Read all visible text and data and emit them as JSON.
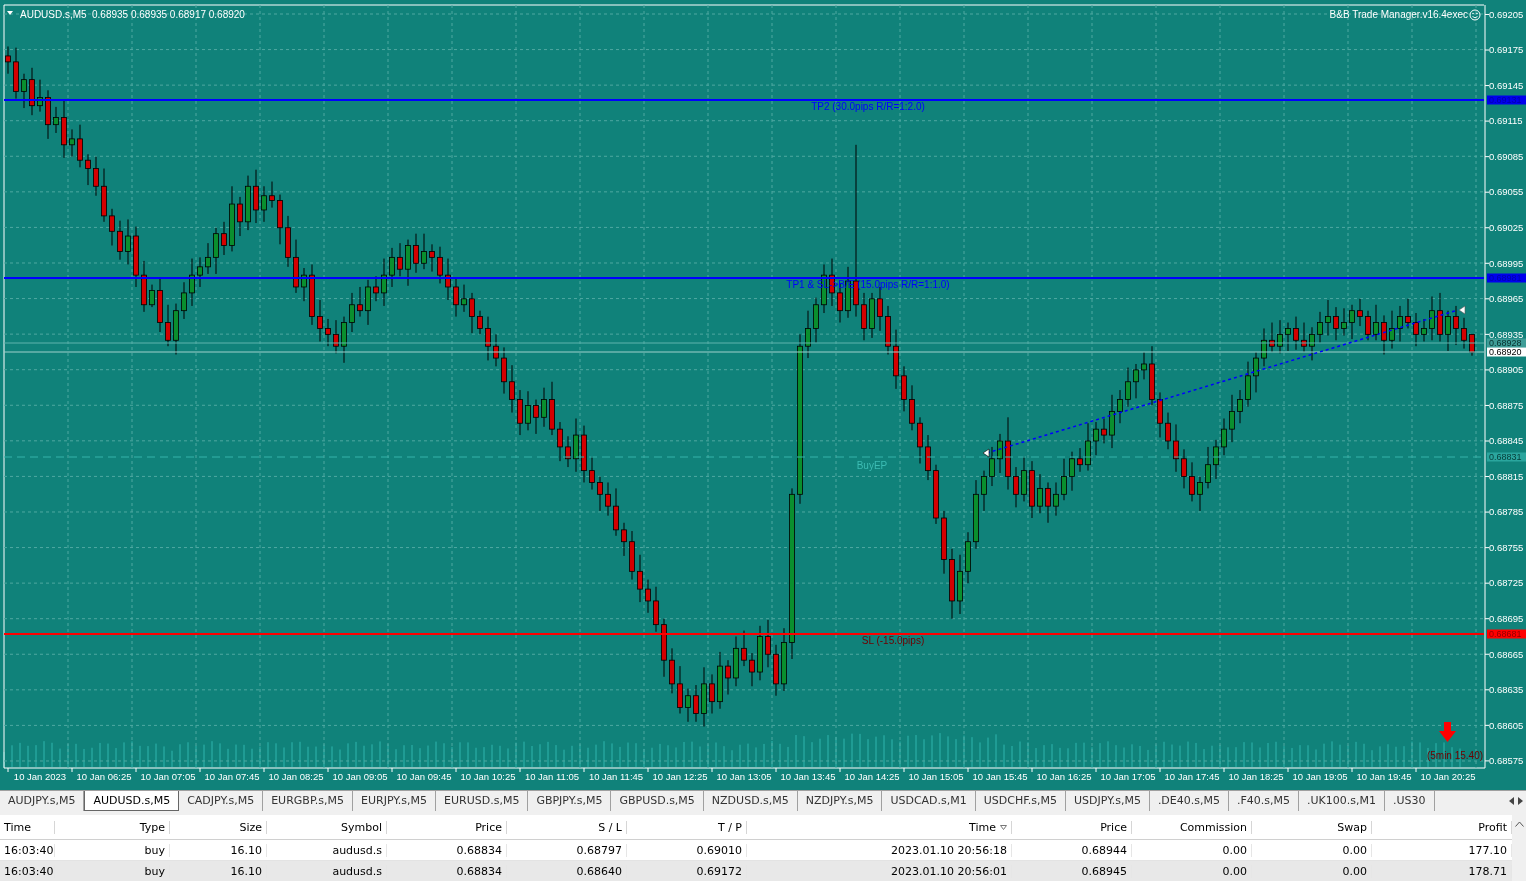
{
  "chart": {
    "symbol": "AUDUSD.s,M5",
    "ohlc": "0.68935 0.68935 0.68917 0.68920",
    "expert": "B&B Trade Manager.v16.4exec",
    "levels": [
      {
        "kind": "take_profit",
        "label": "TP2 (30.0pips R/R=1:2.0)",
        "price": "0.69131"
      },
      {
        "kind": "take_profit",
        "label": "TP1 & SL->B/E (15.0pips R/R=1:1.0)",
        "price": "0.68981"
      },
      {
        "kind": "ask",
        "price": "0.68928"
      },
      {
        "kind": "bid",
        "price": "0.68920"
      },
      {
        "kind": "entry",
        "label": "BuyEP",
        "price": "0.68831"
      },
      {
        "kind": "stop_loss",
        "label": "SL (-15.0pips)",
        "price": "0.68681"
      }
    ],
    "timer": "(5min 15.40)",
    "chart_data": {
      "type": "candlestick",
      "grid": true,
      "categories": [
        null,
        null,
        null,
        null,
        "10 Jan 2023",
        null,
        null,
        null,
        null,
        null,
        null,
        null,
        "10 Jan 06:25",
        null,
        null,
        null,
        null,
        null,
        null,
        null,
        "10 Jan 07:05",
        null,
        null,
        null,
        null,
        null,
        null,
        null,
        "10 Jan 07:45",
        null,
        null,
        null,
        null,
        null,
        null,
        null,
        "10 Jan 08:25",
        null,
        null,
        null,
        null,
        null,
        null,
        null,
        "10 Jan 09:05",
        null,
        null,
        null,
        null,
        null,
        null,
        null,
        "10 Jan 09:45",
        null,
        null,
        null,
        null,
        null,
        null,
        null,
        "10 Jan 10:25",
        null,
        null,
        null,
        null,
        null,
        null,
        null,
        "10 Jan 11:05",
        null,
        null,
        null,
        null,
        null,
        null,
        null,
        "10 Jan 11:45",
        null,
        null,
        null,
        null,
        null,
        null,
        null,
        "10 Jan 12:25",
        null,
        null,
        null,
        null,
        null,
        null,
        null,
        "10 Jan 13:05",
        null,
        null,
        null,
        null,
        null,
        null,
        null,
        "10 Jan 13:45",
        null,
        null,
        null,
        null,
        null,
        null,
        null,
        "10 Jan 14:25",
        null,
        null,
        null,
        null,
        null,
        null,
        null,
        "10 Jan 15:05",
        null,
        null,
        null,
        null,
        null,
        null,
        null,
        "10 Jan 15:45",
        null,
        null,
        null,
        null,
        null,
        null,
        null,
        "10 Jan 16:25",
        null,
        null,
        null,
        null,
        null,
        null,
        null,
        "10 Jan 17:05",
        null,
        null,
        null,
        null,
        null,
        null,
        null,
        "10 Jan 17:45",
        null,
        null,
        null,
        null,
        null,
        null,
        null,
        "10 Jan 18:25",
        null,
        null,
        null,
        null,
        null,
        null,
        null,
        "10 Jan 19:05",
        null,
        null,
        null,
        null,
        null,
        null,
        null,
        "10 Jan 19:45",
        null,
        null,
        null,
        null,
        null,
        null,
        null,
        "10 Jan 20:25",
        null,
        null,
        null
      ],
      "ylim": [
        0.68569,
        0.69213
      ],
      "yticks": [
        0.69205,
        0.69175,
        0.69145,
        0.69115,
        0.69085,
        0.69055,
        0.69025,
        0.68995,
        0.68965,
        0.68935,
        0.68905,
        0.68875,
        0.68845,
        0.68815,
        0.68785,
        0.68755,
        0.68725,
        0.68695,
        0.68665,
        0.68635,
        0.68605,
        0.68575
      ],
      "ohlc": [
        [
          0.6917,
          0.69178,
          0.69155,
          0.69165
        ],
        [
          0.69165,
          0.69177,
          0.69134,
          0.6914
        ],
        [
          0.6914,
          0.69155,
          0.69126,
          0.6915
        ],
        [
          0.6915,
          0.6916,
          0.6912,
          0.69128
        ],
        [
          0.69128,
          0.6915,
          0.69123,
          0.69135
        ],
        [
          0.69135,
          0.69141,
          0.691,
          0.69112
        ],
        [
          0.69112,
          0.69127,
          0.69105,
          0.69118
        ],
        [
          0.69118,
          0.69132,
          0.69084,
          0.69095
        ],
        [
          0.69095,
          0.69108,
          0.69085,
          0.691
        ],
        [
          0.691,
          0.69112,
          0.69076,
          0.69082
        ],
        [
          0.69082,
          0.69087,
          0.69061,
          0.69075
        ],
        [
          0.69075,
          0.69085,
          0.69052,
          0.6906
        ],
        [
          0.6906,
          0.69075,
          0.6903,
          0.69035
        ],
        [
          0.69035,
          0.69041,
          0.6901,
          0.69022
        ],
        [
          0.69022,
          0.69031,
          0.68998,
          0.69005
        ],
        [
          0.69005,
          0.69032,
          0.68994,
          0.69018
        ],
        [
          0.69018,
          0.69026,
          0.68975,
          0.68985
        ],
        [
          0.68985,
          0.68997,
          0.68954,
          0.6896
        ],
        [
          0.6896,
          0.68977,
          0.68958,
          0.68972
        ],
        [
          0.68972,
          0.68982,
          0.68937,
          0.68945
        ],
        [
          0.68945,
          0.6896,
          0.68925,
          0.6893
        ],
        [
          0.6893,
          0.68961,
          0.68918,
          0.68955
        ],
        [
          0.68955,
          0.68979,
          0.68948,
          0.6897
        ],
        [
          0.6897,
          0.68999,
          0.68959,
          0.68985
        ],
        [
          0.68985,
          0.69,
          0.68975,
          0.68992
        ],
        [
          0.68992,
          0.69012,
          0.68986,
          0.69
        ],
        [
          0.69,
          0.69025,
          0.68986,
          0.6902
        ],
        [
          0.6902,
          0.6903,
          0.69002,
          0.6901
        ],
        [
          0.6901,
          0.6906,
          0.69005,
          0.69045
        ],
        [
          0.69045,
          0.69051,
          0.69018,
          0.6903
        ],
        [
          0.6903,
          0.69069,
          0.69023,
          0.6906
        ],
        [
          0.6906,
          0.69074,
          0.69029,
          0.6904
        ],
        [
          0.6904,
          0.6906,
          0.6903,
          0.69052
        ],
        [
          0.69052,
          0.69064,
          0.69042,
          0.69048
        ],
        [
          0.69048,
          0.69053,
          0.69011,
          0.69025
        ],
        [
          0.69025,
          0.69035,
          0.68992,
          0.69
        ],
        [
          0.69,
          0.69015,
          0.6897,
          0.68975
        ],
        [
          0.68975,
          0.68991,
          0.68963,
          0.68985
        ],
        [
          0.68985,
          0.68994,
          0.68943,
          0.6895
        ],
        [
          0.6895,
          0.68964,
          0.68929,
          0.6894
        ],
        [
          0.6894,
          0.68948,
          0.68925,
          0.68935
        ],
        [
          0.68935,
          0.68947,
          0.68919,
          0.68925
        ],
        [
          0.68925,
          0.6895,
          0.68911,
          0.68945
        ],
        [
          0.68945,
          0.6897,
          0.68937,
          0.6896
        ],
        [
          0.6896,
          0.68975,
          0.6895,
          0.68955
        ],
        [
          0.68955,
          0.68981,
          0.68943,
          0.68975
        ],
        [
          0.68975,
          0.68984,
          0.68963,
          0.6897
        ],
        [
          0.6897,
          0.68999,
          0.68959,
          0.68985
        ],
        [
          0.68985,
          0.69008,
          0.68975,
          0.69
        ],
        [
          0.69,
          0.69012,
          0.68984,
          0.6899
        ],
        [
          0.6899,
          0.69015,
          0.68976,
          0.6901
        ],
        [
          0.6901,
          0.6902,
          0.68987,
          0.68995
        ],
        [
          0.68995,
          0.6902,
          0.6899,
          0.69005
        ],
        [
          0.69005,
          0.69011,
          0.68988,
          0.69
        ],
        [
          0.69,
          0.69009,
          0.68978,
          0.68985
        ],
        [
          0.68985,
          0.68999,
          0.68964,
          0.68975
        ],
        [
          0.68975,
          0.68983,
          0.6895,
          0.6896
        ],
        [
          0.6896,
          0.68977,
          0.68954,
          0.68965
        ],
        [
          0.68965,
          0.6897,
          0.68936,
          0.6895
        ],
        [
          0.6895,
          0.68955,
          0.68935,
          0.6894
        ],
        [
          0.6894,
          0.6895,
          0.68913,
          0.68925
        ],
        [
          0.68925,
          0.68935,
          0.68908,
          0.68915
        ],
        [
          0.68915,
          0.68924,
          0.68885,
          0.68895
        ],
        [
          0.68895,
          0.68909,
          0.68869,
          0.6888
        ],
        [
          0.6888,
          0.68888,
          0.6885,
          0.6886
        ],
        [
          0.6886,
          0.68887,
          0.68854,
          0.68875
        ],
        [
          0.68875,
          0.6888,
          0.68851,
          0.68865
        ],
        [
          0.68865,
          0.6889,
          0.68857,
          0.6888
        ],
        [
          0.6888,
          0.68895,
          0.6885,
          0.68855
        ],
        [
          0.68855,
          0.68861,
          0.68828,
          0.6884
        ],
        [
          0.6884,
          0.68849,
          0.68823,
          0.6883
        ],
        [
          0.6883,
          0.68864,
          0.68819,
          0.6885
        ],
        [
          0.6885,
          0.68858,
          0.6881,
          0.6882
        ],
        [
          0.6882,
          0.68832,
          0.68804,
          0.6881
        ],
        [
          0.6881,
          0.68815,
          0.68786,
          0.688
        ],
        [
          0.688,
          0.6881,
          0.68782,
          0.6879
        ],
        [
          0.6879,
          0.68805,
          0.68765,
          0.6877
        ],
        [
          0.6877,
          0.68776,
          0.68748,
          0.6876
        ],
        [
          0.6876,
          0.68769,
          0.68728,
          0.68735
        ],
        [
          0.68735,
          0.68749,
          0.68709,
          0.6872
        ],
        [
          0.6872,
          0.68728,
          0.687,
          0.6871
        ],
        [
          0.6871,
          0.68722,
          0.68684,
          0.6869
        ],
        [
          0.6869,
          0.68695,
          0.68646,
          0.6866
        ],
        [
          0.6866,
          0.6867,
          0.68632,
          0.6864
        ],
        [
          0.6864,
          0.68655,
          0.68615,
          0.6862
        ],
        [
          0.6862,
          0.68636,
          0.68608,
          0.6863
        ],
        [
          0.6863,
          0.68639,
          0.68608,
          0.68615
        ],
        [
          0.68615,
          0.68654,
          0.68604,
          0.6864
        ],
        [
          0.6864,
          0.68648,
          0.68615,
          0.68625
        ],
        [
          0.68625,
          0.68667,
          0.68619,
          0.68655
        ],
        [
          0.68655,
          0.6866,
          0.68631,
          0.68645
        ],
        [
          0.68645,
          0.6868,
          0.68638,
          0.6867
        ],
        [
          0.6867,
          0.68685,
          0.68655,
          0.6866
        ],
        [
          0.6866,
          0.68666,
          0.68638,
          0.6865
        ],
        [
          0.6865,
          0.68689,
          0.68643,
          0.6868
        ],
        [
          0.6868,
          0.68694,
          0.68654,
          0.68665
        ],
        [
          0.68665,
          0.68673,
          0.6863,
          0.6864
        ],
        [
          0.6864,
          0.68687,
          0.68634,
          0.68675
        ],
        [
          0.68675,
          0.68805,
          0.68661,
          0.688
        ],
        [
          0.688,
          0.68935,
          0.68792,
          0.68925
        ],
        [
          0.68925,
          0.68955,
          0.68915,
          0.6894
        ],
        [
          0.6894,
          0.68966,
          0.68928,
          0.6896
        ],
        [
          0.6896,
          0.68994,
          0.68953,
          0.68985
        ],
        [
          0.68985,
          0.68999,
          0.68959,
          0.6897
        ],
        [
          0.6897,
          0.68978,
          0.68945,
          0.68955
        ],
        [
          0.68955,
          0.68992,
          0.68949,
          0.6898
        ],
        [
          0.6898,
          0.69095,
          0.6895,
          0.6896
        ],
        [
          0.6896,
          0.6897,
          0.6893,
          0.6894
        ],
        [
          0.6894,
          0.6897,
          0.68932,
          0.68965
        ],
        [
          0.68965,
          0.68975,
          0.68938,
          0.6895
        ],
        [
          0.6895,
          0.68959,
          0.68918,
          0.68925
        ],
        [
          0.68925,
          0.68939,
          0.68889,
          0.689
        ],
        [
          0.689,
          0.68908,
          0.6887,
          0.6888
        ],
        [
          0.6888,
          0.68892,
          0.68854,
          0.6886
        ],
        [
          0.6886,
          0.68865,
          0.68826,
          0.6884
        ],
        [
          0.6884,
          0.6885,
          0.68812,
          0.6882
        ],
        [
          0.6882,
          0.68825,
          0.68775,
          0.6878
        ],
        [
          0.6878,
          0.68786,
          0.68733,
          0.68745
        ],
        [
          0.68745,
          0.68754,
          0.68695,
          0.6871
        ],
        [
          0.6871,
          0.68749,
          0.68699,
          0.68735
        ],
        [
          0.68735,
          0.68768,
          0.68725,
          0.6876
        ],
        [
          0.6876,
          0.68812,
          0.68754,
          0.688
        ],
        [
          0.688,
          0.6882,
          0.68786,
          0.68815
        ],
        [
          0.68815,
          0.6884,
          0.68807,
          0.6883
        ],
        [
          0.6883,
          0.68851,
          0.68818,
          0.68845
        ],
        [
          0.68845,
          0.68865,
          0.68804,
          0.68815
        ],
        [
          0.68815,
          0.68823,
          0.68789,
          0.688
        ],
        [
          0.688,
          0.68832,
          0.68794,
          0.6882
        ],
        [
          0.6882,
          0.68828,
          0.6878,
          0.6879
        ],
        [
          0.6879,
          0.68817,
          0.68784,
          0.68805
        ],
        [
          0.68805,
          0.6881,
          0.68776,
          0.6879
        ],
        [
          0.6879,
          0.6881,
          0.68782,
          0.688
        ],
        [
          0.688,
          0.6883,
          0.68795,
          0.68815
        ],
        [
          0.68815,
          0.68836,
          0.68803,
          0.6883
        ],
        [
          0.6883,
          0.68839,
          0.68819,
          0.68825
        ],
        [
          0.68825,
          0.6886,
          0.6882,
          0.68845
        ],
        [
          0.68845,
          0.68861,
          0.68833,
          0.68855
        ],
        [
          0.68855,
          0.68864,
          0.68843,
          0.6885
        ],
        [
          0.6885,
          0.68884,
          0.68839,
          0.6887
        ],
        [
          0.6887,
          0.68888,
          0.6886,
          0.6888
        ],
        [
          0.6888,
          0.68907,
          0.68874,
          0.68895
        ],
        [
          0.68895,
          0.6891,
          0.68881,
          0.68905
        ],
        [
          0.68905,
          0.6892,
          0.68897,
          0.6891
        ],
        [
          0.6891,
          0.68925,
          0.68875,
          0.6888
        ],
        [
          0.6888,
          0.68886,
          0.68848,
          0.6886
        ],
        [
          0.6886,
          0.68869,
          0.68838,
          0.68845
        ],
        [
          0.68845,
          0.68859,
          0.68819,
          0.6883
        ],
        [
          0.6883,
          0.68838,
          0.68805,
          0.68815
        ],
        [
          0.68815,
          0.68827,
          0.68794,
          0.688
        ],
        [
          0.688,
          0.68815,
          0.68786,
          0.6881
        ],
        [
          0.6881,
          0.6884,
          0.68805,
          0.68825
        ],
        [
          0.68825,
          0.68846,
          0.68813,
          0.6884
        ],
        [
          0.6884,
          0.68864,
          0.68833,
          0.68855
        ],
        [
          0.68855,
          0.68884,
          0.68844,
          0.6887
        ],
        [
          0.6887,
          0.68888,
          0.6886,
          0.6888
        ],
        [
          0.6888,
          0.68912,
          0.68874,
          0.689
        ],
        [
          0.689,
          0.6892,
          0.68886,
          0.68915
        ],
        [
          0.68915,
          0.6894,
          0.68908,
          0.6893
        ],
        [
          0.6893,
          0.68945,
          0.6892,
          0.68925
        ],
        [
          0.68925,
          0.68947,
          0.68919,
          0.68935
        ],
        [
          0.68935,
          0.68945,
          0.68921,
          0.6894
        ],
        [
          0.6894,
          0.6895,
          0.68922,
          0.6893
        ],
        [
          0.6893,
          0.68945,
          0.6892,
          0.68925
        ],
        [
          0.68925,
          0.68941,
          0.68913,
          0.68935
        ],
        [
          0.68935,
          0.68954,
          0.68928,
          0.68945
        ],
        [
          0.68945,
          0.68964,
          0.68934,
          0.6895
        ],
        [
          0.6895,
          0.68958,
          0.6893,
          0.6894
        ],
        [
          0.6894,
          0.68957,
          0.68934,
          0.68945
        ],
        [
          0.68945,
          0.6896,
          0.68931,
          0.68955
        ],
        [
          0.68955,
          0.68965,
          0.68942,
          0.6895
        ],
        [
          0.6895,
          0.68955,
          0.6893,
          0.68935
        ],
        [
          0.68935,
          0.6896,
          0.6893,
          0.68945
        ],
        [
          0.68945,
          0.68951,
          0.68918,
          0.6893
        ],
        [
          0.6893,
          0.68955,
          0.68923,
          0.6894
        ],
        [
          0.6894,
          0.68959,
          0.68929,
          0.6895
        ],
        [
          0.6895,
          0.68965,
          0.6894,
          0.68945
        ],
        [
          0.68945,
          0.68953,
          0.68925,
          0.68935
        ],
        [
          0.68935,
          0.68948,
          0.68929,
          0.6894
        ],
        [
          0.6894,
          0.68967,
          0.6893,
          0.68955
        ],
        [
          0.68955,
          0.6897,
          0.68929,
          0.68935
        ],
        [
          0.68935,
          0.68955,
          0.68921,
          0.6895
        ],
        [
          0.6895,
          0.68959,
          0.68926,
          0.6894
        ],
        [
          0.6894,
          0.68949,
          0.68923,
          0.6893
        ],
        [
          0.68935,
          0.68935,
          0.68917,
          0.6892
        ]
      ]
    }
  },
  "tabs": [
    {
      "label": "AUDJPY.s,M5",
      "selected": false
    },
    {
      "label": "AUDUSD.s,M5",
      "selected": true
    },
    {
      "label": "CADJPY.s,M5",
      "selected": false
    },
    {
      "label": "EURGBP.s,M5",
      "selected": false
    },
    {
      "label": "EURJPY.s,M5",
      "selected": false
    },
    {
      "label": "EURUSD.s,M5",
      "selected": false
    },
    {
      "label": "GBPJPY.s,M5",
      "selected": false
    },
    {
      "label": "GBPUSD.s,M5",
      "selected": false
    },
    {
      "label": "NZDUSD.s,M5",
      "selected": false
    },
    {
      "label": "NZDJPY.s,M5",
      "selected": false
    },
    {
      "label": "USDCAD.s,M1",
      "selected": false
    },
    {
      "label": "USDCHF.s,M5",
      "selected": false
    },
    {
      "label": "USDJPY.s,M5",
      "selected": false
    },
    {
      "label": ".DE40.s,M5",
      "selected": false
    },
    {
      "label": ".F40.s,M5",
      "selected": false
    },
    {
      "label": ".UK100.s,M1",
      "selected": false
    },
    {
      "label": ".US30",
      "selected": false
    }
  ],
  "table": {
    "columns": [
      "Time",
      "Type",
      "Size",
      "Symbol",
      "Price",
      "S / L",
      "T / P",
      "Time",
      "Price",
      "Commission",
      "Swap",
      "Profit"
    ],
    "rows": [
      [
        "16:03:40",
        "buy",
        "16.10",
        "audusd.s",
        "0.68834",
        "0.68797",
        "0.69010",
        "2023.01.10 20:56:18",
        "0.68944",
        "0.00",
        "0.00",
        "177.10"
      ],
      [
        "16:03:40",
        "buy",
        "16.10",
        "audusd.s",
        "0.68834",
        "0.68640",
        "0.69172",
        "2023.01.10 20:56:01",
        "0.68945",
        "0.00",
        "0.00",
        "178.71"
      ]
    ]
  }
}
